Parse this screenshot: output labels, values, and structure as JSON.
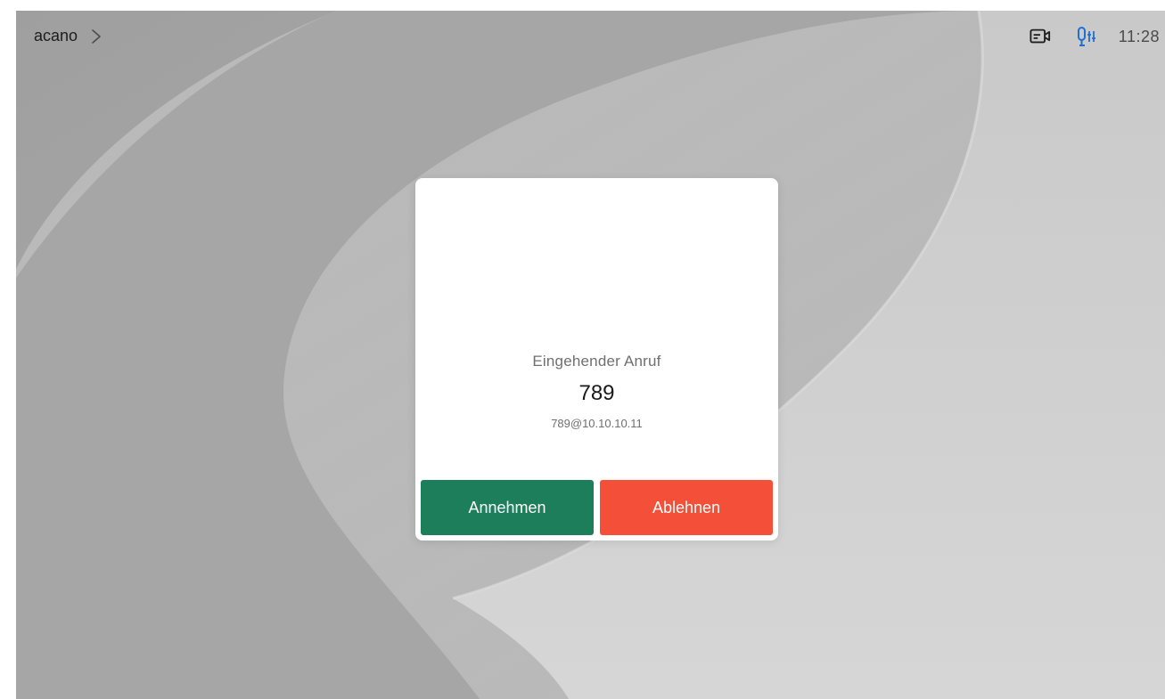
{
  "topbar": {
    "breadcrumb_label": "acano",
    "clock": "11:28",
    "icons": [
      "chevron-right-icon",
      "camera-icon",
      "mic-settings-icon"
    ]
  },
  "dialog": {
    "status": "Eingehender Anruf",
    "caller_name": "789",
    "caller_uri": "789@10.10.10.11",
    "accept_label": "Annehmen",
    "decline_label": "Ablehnen"
  },
  "colors": {
    "accept": "#1d7e5b",
    "decline": "#f44f39",
    "mic_accent": "#1f6fd1",
    "background": "#a9a9a9"
  }
}
